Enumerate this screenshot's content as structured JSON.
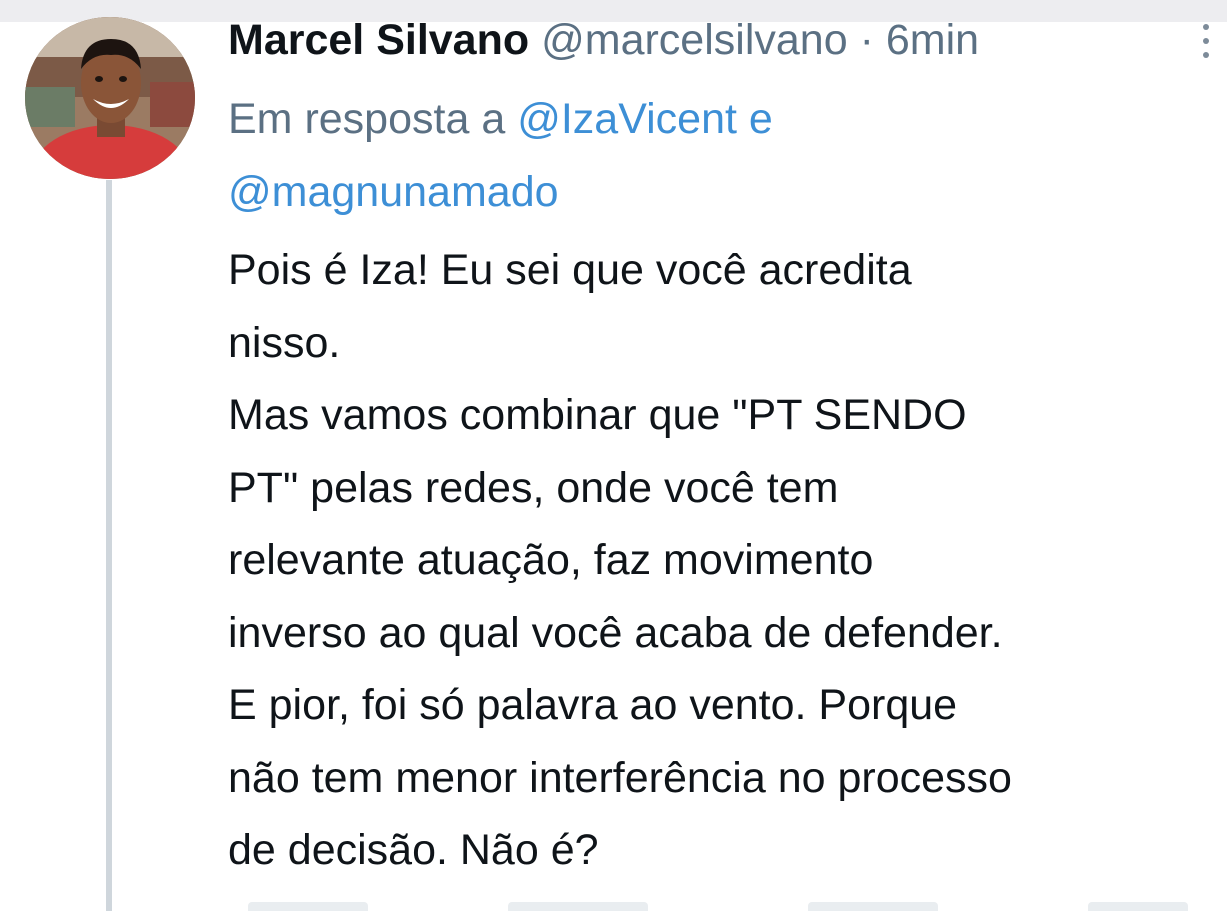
{
  "tweet": {
    "author_name": "Marcel Silvano",
    "handle": "@marcelsilvano",
    "separator": "·",
    "timestamp": "6min",
    "reply_prefix": "Em resposta a",
    "reply_mentions": [
      "@IzaVicent",
      "@magnunamado"
    ],
    "reply_joiner": "e",
    "text_lines": [
      "Pois é Iza! Eu sei que você acredita",
      "nisso.",
      "Mas vamos combinar que \"PT SENDO",
      "PT\" pelas redes, onde você tem",
      "relevante atuação, faz movimento",
      "inverso ao qual você acaba de defender.",
      "E pior, foi só palavra ao vento. Porque",
      "não tem menor interferência no processo",
      "de decisão. Não é?"
    ]
  },
  "colors": {
    "text_primary": "#0f1419",
    "text_secondary": "#5b7083",
    "link": "#3d8fd6",
    "thread_line": "#cfd6dc"
  },
  "icons": {
    "menu": "more-vertical-icon",
    "avatar": "profile-photo"
  }
}
